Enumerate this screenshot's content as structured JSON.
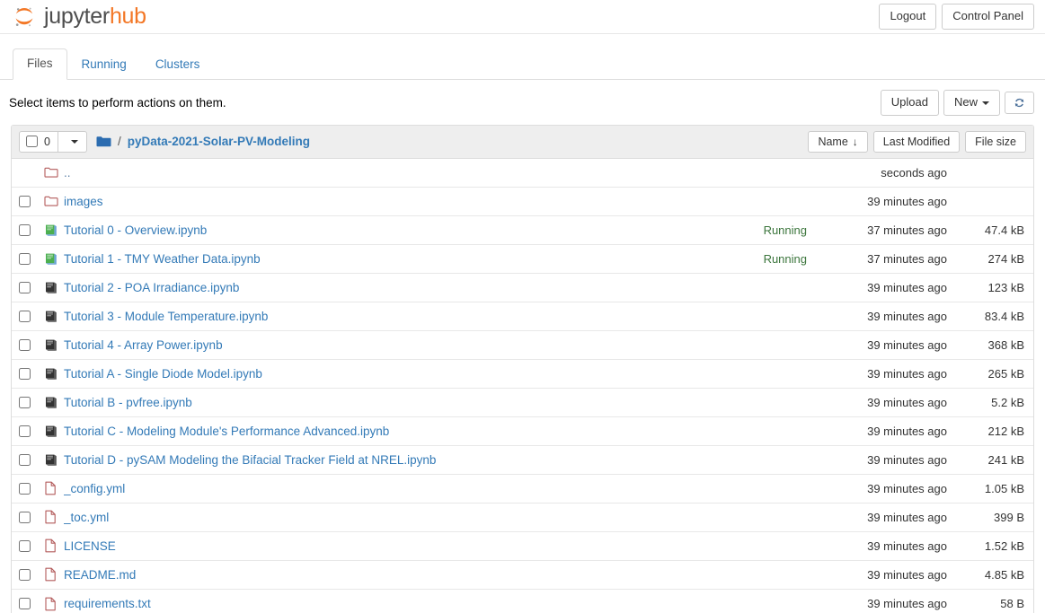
{
  "brand": {
    "jupyter": "jupyter",
    "hub": "hub"
  },
  "header": {
    "logout_label": "Logout",
    "control_panel_label": "Control Panel"
  },
  "tabs": [
    {
      "label": "Files",
      "active": true
    },
    {
      "label": "Running",
      "active": false
    },
    {
      "label": "Clusters",
      "active": false
    }
  ],
  "toolbar": {
    "message": "Select items to perform actions on them.",
    "upload_label": "Upload",
    "new_label": "New",
    "refresh_label": "Refresh"
  },
  "list_header": {
    "selected_count": "0",
    "breadcrumb_separator": "/",
    "breadcrumb_path": "pyData-2021-Solar-PV-Modeling",
    "sort_name": "Name",
    "sort_name_arrow": "↓",
    "sort_modified": "Last Modified",
    "sort_size": "File size"
  },
  "colors": {
    "brand_orange": "#f37726",
    "link_blue": "#337ab7",
    "running_green": "#3c763d",
    "folder_icon": "#b35b5b",
    "notebook_running": "#4caf50",
    "notebook_idle": "#333333"
  },
  "files": [
    {
      "name": "..",
      "icon": "folder-icon",
      "type": "updir",
      "status": "",
      "modified": "seconds ago",
      "size": ""
    },
    {
      "name": "images",
      "icon": "folder-icon",
      "type": "folder",
      "status": "",
      "modified": "39 minutes ago",
      "size": ""
    },
    {
      "name": "Tutorial 0 - Overview.ipynb",
      "icon": "notebook-running-icon",
      "type": "notebook-running",
      "status": "Running",
      "modified": "37 minutes ago",
      "size": "47.4 kB"
    },
    {
      "name": "Tutorial 1 - TMY Weather Data.ipynb",
      "icon": "notebook-running-icon",
      "type": "notebook-running",
      "status": "Running",
      "modified": "37 minutes ago",
      "size": "274 kB"
    },
    {
      "name": "Tutorial 2 - POA Irradiance.ipynb",
      "icon": "notebook-icon",
      "type": "notebook",
      "status": "",
      "modified": "39 minutes ago",
      "size": "123 kB"
    },
    {
      "name": "Tutorial 3 - Module Temperature.ipynb",
      "icon": "notebook-icon",
      "type": "notebook",
      "status": "",
      "modified": "39 minutes ago",
      "size": "83.4 kB"
    },
    {
      "name": "Tutorial 4 - Array Power.ipynb",
      "icon": "notebook-icon",
      "type": "notebook",
      "status": "",
      "modified": "39 minutes ago",
      "size": "368 kB"
    },
    {
      "name": "Tutorial A - Single Diode Model.ipynb",
      "icon": "notebook-icon",
      "type": "notebook",
      "status": "",
      "modified": "39 minutes ago",
      "size": "265 kB"
    },
    {
      "name": "Tutorial B - pvfree.ipynb",
      "icon": "notebook-icon",
      "type": "notebook",
      "status": "",
      "modified": "39 minutes ago",
      "size": "5.2 kB"
    },
    {
      "name": "Tutorial C - Modeling Module's Performance Advanced.ipynb",
      "icon": "notebook-icon",
      "type": "notebook",
      "status": "",
      "modified": "39 minutes ago",
      "size": "212 kB"
    },
    {
      "name": "Tutorial D - pySAM Modeling the Bifacial Tracker Field at NREL.ipynb",
      "icon": "notebook-icon",
      "type": "notebook",
      "status": "",
      "modified": "39 minutes ago",
      "size": "241 kB"
    },
    {
      "name": "_config.yml",
      "icon": "file-icon",
      "type": "file",
      "status": "",
      "modified": "39 minutes ago",
      "size": "1.05 kB"
    },
    {
      "name": "_toc.yml",
      "icon": "file-icon",
      "type": "file",
      "status": "",
      "modified": "39 minutes ago",
      "size": "399 B"
    },
    {
      "name": "LICENSE",
      "icon": "file-icon",
      "type": "file",
      "status": "",
      "modified": "39 minutes ago",
      "size": "1.52 kB"
    },
    {
      "name": "README.md",
      "icon": "file-icon",
      "type": "file",
      "status": "",
      "modified": "39 minutes ago",
      "size": "4.85 kB"
    },
    {
      "name": "requirements.txt",
      "icon": "file-icon",
      "type": "file",
      "status": "",
      "modified": "39 minutes ago",
      "size": "58 B"
    }
  ]
}
